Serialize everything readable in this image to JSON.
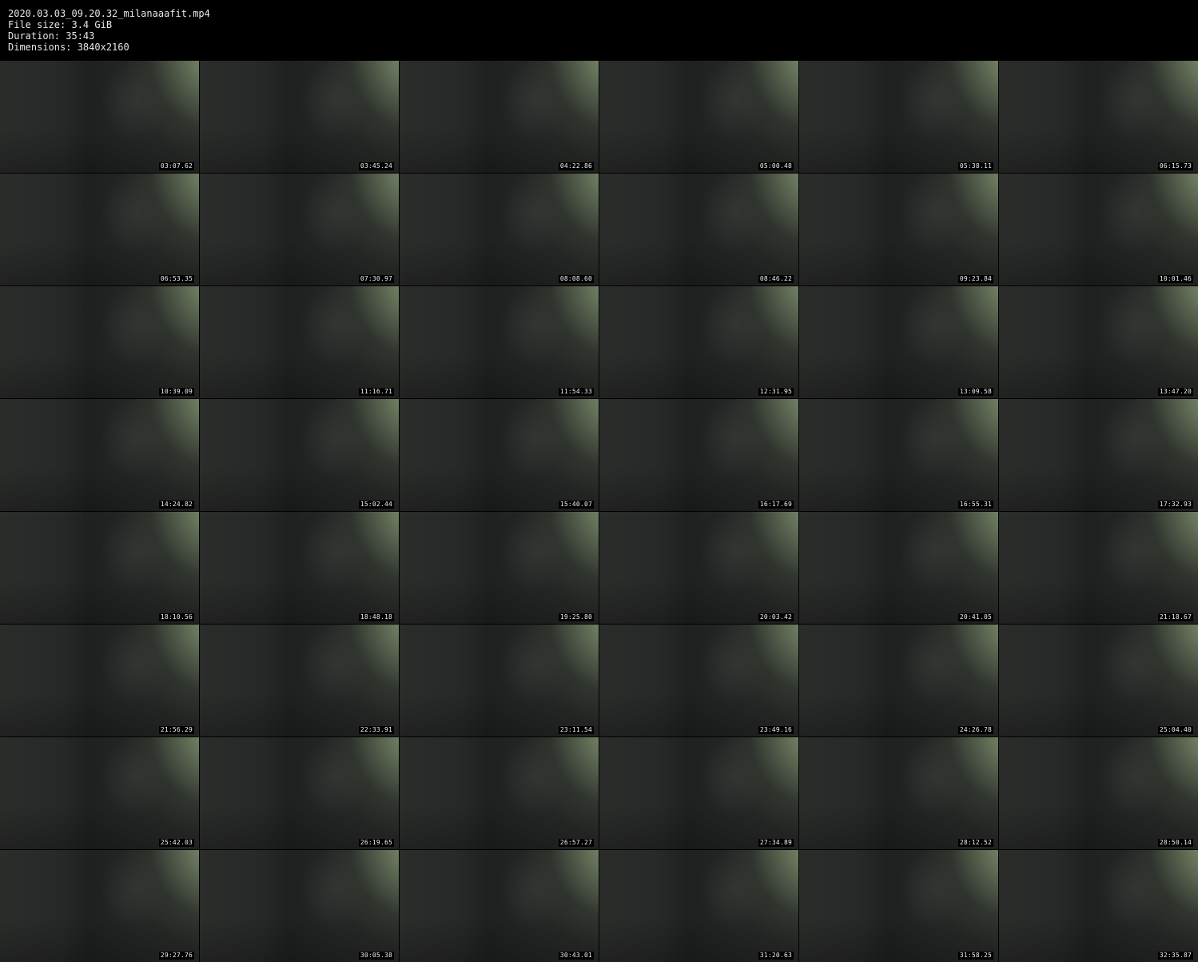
{
  "header": {
    "filename": "2020.03.03_09.20.32_milanaaafit.mp4",
    "file_size": "File size: 3.4 GiB",
    "duration": "Duration: 35:43",
    "dimensions": "Dimensions: 3840x2160"
  },
  "thumbnails": [
    {
      "timestamp": "03:07.62"
    },
    {
      "timestamp": "03:45.24"
    },
    {
      "timestamp": "04:22.86"
    },
    {
      "timestamp": "05:00.48"
    },
    {
      "timestamp": "05:38.11"
    },
    {
      "timestamp": "06:15.73"
    },
    {
      "timestamp": "06:53.35"
    },
    {
      "timestamp": "07:30.97"
    },
    {
      "timestamp": "08:08.60"
    },
    {
      "timestamp": "08:46.22"
    },
    {
      "timestamp": "09:23.84"
    },
    {
      "timestamp": "10:01.46"
    },
    {
      "timestamp": "10:39.09"
    },
    {
      "timestamp": "11:16.71"
    },
    {
      "timestamp": "11:54.33"
    },
    {
      "timestamp": "12:31.95"
    },
    {
      "timestamp": "13:09.58"
    },
    {
      "timestamp": "13:47.20"
    },
    {
      "timestamp": "14:24.82"
    },
    {
      "timestamp": "15:02.44"
    },
    {
      "timestamp": "15:40.07"
    },
    {
      "timestamp": "16:17.69"
    },
    {
      "timestamp": "16:55.31"
    },
    {
      "timestamp": "17:32.93"
    },
    {
      "timestamp": "18:10.56"
    },
    {
      "timestamp": "18:48.18"
    },
    {
      "timestamp": "19:25.80"
    },
    {
      "timestamp": "20:03.42"
    },
    {
      "timestamp": "20:41.05"
    },
    {
      "timestamp": "21:18.67"
    },
    {
      "timestamp": "21:56.29"
    },
    {
      "timestamp": "22:33.91"
    },
    {
      "timestamp": "23:11.54"
    },
    {
      "timestamp": "23:49.16"
    },
    {
      "timestamp": "24:26.78"
    },
    {
      "timestamp": "25:04.40"
    },
    {
      "timestamp": "25:42.03"
    },
    {
      "timestamp": "26:19.65"
    },
    {
      "timestamp": "26:57.27"
    },
    {
      "timestamp": "27:34.89"
    },
    {
      "timestamp": "28:12.52"
    },
    {
      "timestamp": "28:50.14"
    },
    {
      "timestamp": "29:27.76"
    },
    {
      "timestamp": "30:05.38"
    },
    {
      "timestamp": "30:43.01"
    },
    {
      "timestamp": "31:20.63"
    },
    {
      "timestamp": "31:58.25"
    },
    {
      "timestamp": "32:35.87"
    }
  ]
}
